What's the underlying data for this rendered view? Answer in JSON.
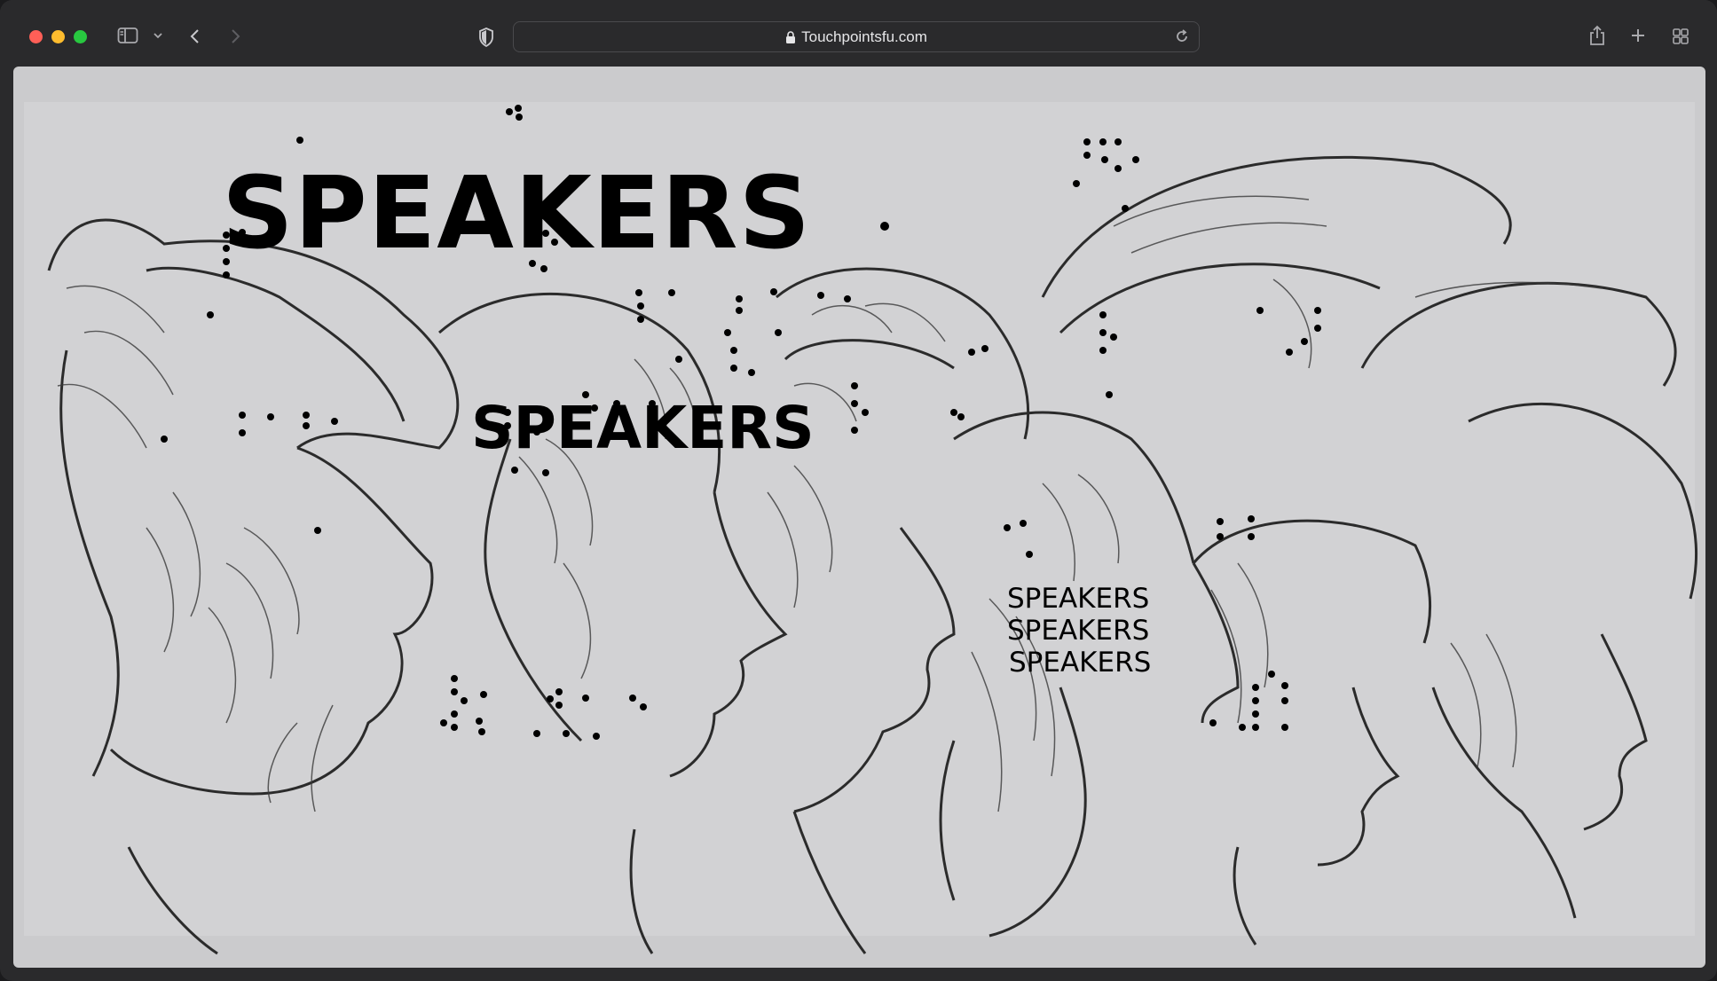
{
  "browser": {
    "url": "Touchpointsfu.com",
    "icons": {
      "sidebar": "sidebar-icon",
      "back": "chevron-left-icon",
      "forward": "chevron-right-icon",
      "privacy": "shield-icon",
      "lock": "lock-icon",
      "reload": "reload-icon",
      "share": "share-icon",
      "new_tab": "plus-icon",
      "tab_overview": "grid-icon"
    }
  },
  "page": {
    "headline_large": "SPEAKERS",
    "headline_medium": "SPEAKERS",
    "headline_small": [
      "SPEAKERS",
      "SPEAKERS",
      "SPEAKERS"
    ]
  },
  "colors": {
    "chrome": "#2a2a2c",
    "page_background": "#cbcbcd",
    "text": "#000000"
  }
}
